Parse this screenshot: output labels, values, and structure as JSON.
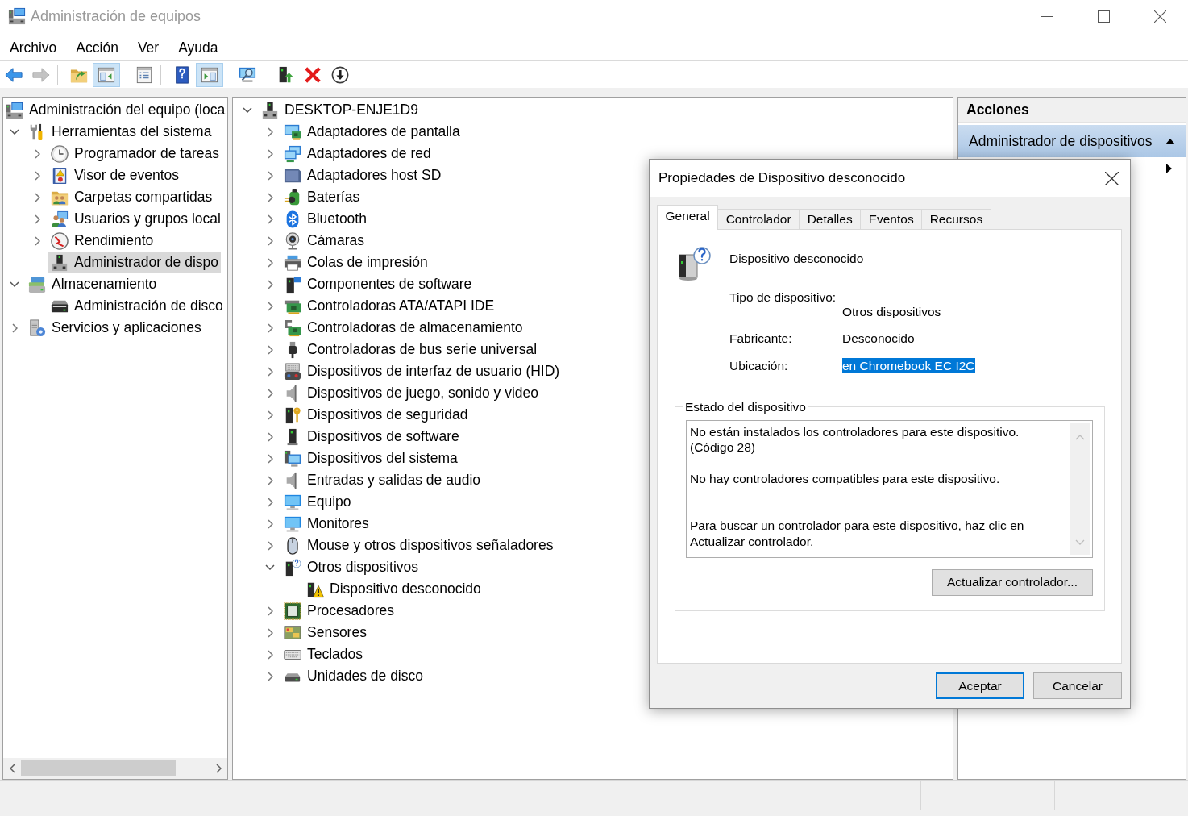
{
  "window": {
    "title": "Administración de equipos"
  },
  "menu": [
    "Archivo",
    "Acción",
    "Ver",
    "Ayuda"
  ],
  "toolbar": {
    "groups": [
      [
        {
          "kind": "back",
          "pressed": false,
          "disabled": false
        },
        {
          "kind": "forward",
          "pressed": false,
          "disabled": true
        }
      ],
      [
        {
          "kind": "up",
          "pressed": false,
          "disabled": false
        },
        {
          "kind": "tree",
          "pressed": true,
          "disabled": false
        }
      ],
      [
        {
          "kind": "properties",
          "pressed": false,
          "disabled": false
        }
      ],
      [
        {
          "kind": "help",
          "pressed": false,
          "disabled": false
        },
        {
          "kind": "actionpane",
          "pressed": true,
          "disabled": false
        }
      ],
      [
        {
          "kind": "scan",
          "pressed": false,
          "disabled": false
        }
      ],
      [
        {
          "kind": "update",
          "pressed": false,
          "disabled": false
        },
        {
          "kind": "uninstall",
          "pressed": false,
          "disabled": false
        },
        {
          "kind": "disable",
          "pressed": false,
          "disabled": false
        }
      ]
    ]
  },
  "console_tree": {
    "items": [
      {
        "label": "Administración del equipo (loca",
        "kind": "computer",
        "selected": false,
        "children": [
          {
            "label": "Herramientas del sistema",
            "kind": "tools",
            "expanded": true,
            "selected": false,
            "children": [
              {
                "label": "Programador de tareas",
                "kind": "clock",
                "expanded": false,
                "selected": false
              },
              {
                "label": "Visor de eventos",
                "kind": "log",
                "expanded": false,
                "selected": false
              },
              {
                "label": "Carpetas compartidas",
                "kind": "shared",
                "expanded": false,
                "selected": false
              },
              {
                "label": "Usuarios y grupos local",
                "kind": "users",
                "expanded": false,
                "selected": false
              },
              {
                "label": "Rendimiento",
                "kind": "gauge",
                "expanded": false,
                "selected": false
              },
              {
                "label": "Administrador de dispo",
                "kind": "device",
                "selected": true
              }
            ]
          },
          {
            "label": "Almacenamiento",
            "kind": "storage",
            "expanded": true,
            "selected": false,
            "children": [
              {
                "label": "Administración de disco",
                "kind": "diskmgmt",
                "selected": false
              }
            ]
          },
          {
            "label": "Servicios y aplicaciones",
            "kind": "services",
            "expanded": false,
            "selected": false
          }
        ]
      }
    ]
  },
  "device_tree": {
    "items": [
      {
        "label": "DESKTOP-ENJE1D9",
        "kind": "device",
        "expanded": true,
        "selected": false,
        "children": [
          {
            "label": "Adaptadores de pantalla",
            "kind": "display",
            "expanded": false,
            "selected": false
          },
          {
            "label": "Adaptadores de red",
            "kind": "network",
            "expanded": false,
            "selected": false
          },
          {
            "label": "Adaptadores host SD",
            "kind": "sdhost",
            "expanded": false,
            "selected": false
          },
          {
            "label": "Baterías",
            "kind": "battery",
            "expanded": false,
            "selected": false
          },
          {
            "label": "Bluetooth",
            "kind": "bluetooth",
            "expanded": false,
            "selected": false
          },
          {
            "label": "Cámaras",
            "kind": "camera",
            "expanded": false,
            "selected": false
          },
          {
            "label": "Colas de impresión",
            "kind": "printer",
            "expanded": false,
            "selected": false
          },
          {
            "label": "Componentes de software",
            "kind": "component",
            "expanded": false,
            "selected": false
          },
          {
            "label": "Controladoras ATA/ATAPI IDE",
            "kind": "ide",
            "expanded": false,
            "selected": false
          },
          {
            "label": "Controladoras de almacenamiento",
            "kind": "storagectl",
            "expanded": false,
            "selected": false
          },
          {
            "label": "Controladoras de bus serie universal",
            "kind": "usb",
            "expanded": false,
            "selected": false
          },
          {
            "label": "Dispositivos de interfaz de usuario (HID)",
            "kind": "hid",
            "expanded": false,
            "selected": false
          },
          {
            "label": "Dispositivos de juego, sonido y video",
            "kind": "sound",
            "expanded": false,
            "selected": false
          },
          {
            "label": "Dispositivos de seguridad",
            "kind": "security",
            "expanded": false,
            "selected": false
          },
          {
            "label": "Dispositivos de software",
            "kind": "softdev",
            "expanded": false,
            "selected": false
          },
          {
            "label": "Dispositivos del sistema",
            "kind": "system",
            "expanded": false,
            "selected": false
          },
          {
            "label": "Entradas y salidas de audio",
            "kind": "audio",
            "expanded": false,
            "selected": false
          },
          {
            "label": "Equipo",
            "kind": "pc",
            "expanded": false,
            "selected": false
          },
          {
            "label": "Monitores",
            "kind": "monitor",
            "expanded": false,
            "selected": false
          },
          {
            "label": "Mouse y otros dispositivos señaladores",
            "kind": "mouse",
            "expanded": false,
            "selected": false
          },
          {
            "label": "Otros dispositivos",
            "kind": "other",
            "expanded": true,
            "selected": false,
            "children": [
              {
                "label": "Dispositivo desconocido",
                "kind": "unknown",
                "selected": false
              }
            ]
          },
          {
            "label": "Procesadores",
            "kind": "cpu",
            "expanded": false,
            "selected": false
          },
          {
            "label": "Sensores",
            "kind": "sensor",
            "expanded": false,
            "selected": false
          },
          {
            "label": "Teclados",
            "kind": "keyboard",
            "expanded": false,
            "selected": false
          },
          {
            "label": "Unidades de disco",
            "kind": "disk",
            "expanded": false,
            "selected": false
          }
        ]
      }
    ]
  },
  "actions": {
    "title": "Acciones",
    "section": {
      "label": "Administrador de dispositivos",
      "expanded": true
    }
  },
  "dialog": {
    "title": "Propiedades de Dispositivo desconocido",
    "tabs": [
      {
        "label": "General",
        "selected": true
      },
      {
        "label": "Controlador",
        "selected": false
      },
      {
        "label": "Detalles",
        "selected": false
      },
      {
        "label": "Eventos",
        "selected": false
      },
      {
        "label": "Recursos",
        "selected": false
      }
    ],
    "device_name": "Dispositivo desconocido",
    "properties": [
      {
        "label": "Tipo de dispositivo:",
        "value": "Otros dispositivos",
        "selected": false
      },
      {
        "label": "Fabricante:",
        "value": "Desconocido",
        "selected": false
      },
      {
        "label": "Ubicación:",
        "value": "en Chromebook EC I2C",
        "selected": true
      }
    ],
    "status": {
      "title": "Estado del dispositivo",
      "text": "No están instalados los controladores para este dispositivo. (Código 28)\n\nNo hay controladores compatibles para este dispositivo.\n\n\nPara buscar un controlador para este dispositivo, haz clic en Actualizar controlador."
    },
    "update_button": "Actualizar controlador...",
    "buttons": [
      {
        "label": "Aceptar",
        "default": true
      },
      {
        "label": "Cancelar",
        "default": false
      }
    ]
  }
}
